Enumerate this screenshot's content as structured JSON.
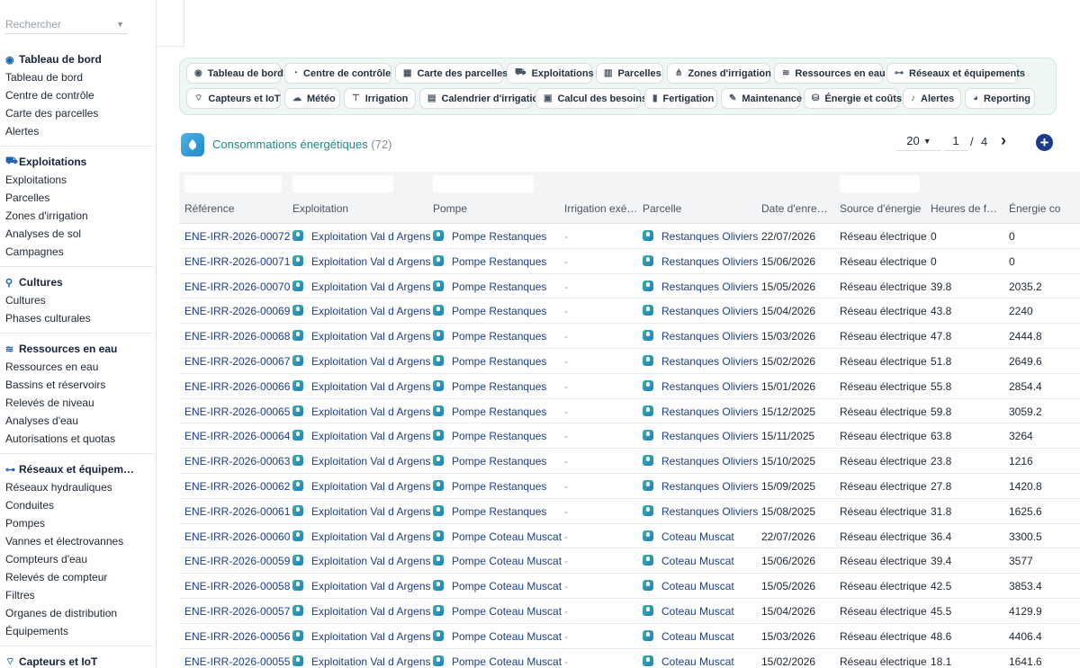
{
  "search": {
    "placeholder": "Rechercher"
  },
  "sidebar": {
    "sections": [
      {
        "title": "Tableau de bord",
        "icon": "dashboard-icon",
        "items": [
          "Tableau de bord",
          "Centre de contrôle",
          "Carte des parcelles",
          "Alertes"
        ]
      },
      {
        "title": "Exploitations",
        "icon": "tractor-icon",
        "items": [
          "Exploitations",
          "Parcelles",
          "Zones d'irrigation",
          "Analyses de sol",
          "Campagnes"
        ]
      },
      {
        "title": "Cultures",
        "icon": "sprout-icon",
        "items": [
          "Cultures",
          "Phases culturales"
        ]
      },
      {
        "title": "Ressources en eau",
        "icon": "water-waves-icon",
        "items": [
          "Ressources en eau",
          "Bassins et réservoirs",
          "Relevés de niveau",
          "Analyses d'eau",
          "Autorisations et quotas"
        ]
      },
      {
        "title": "Réseaux et équipem…",
        "icon": "network-icon",
        "items": [
          "Réseaux hydrauliques",
          "Conduites",
          "Pompes",
          "Vannes et électrovannes",
          "Compteurs d'eau",
          "Relevés de compteur",
          "Filtres",
          "Organes de distribution",
          "Équipements"
        ]
      },
      {
        "title": "Capteurs et IoT",
        "icon": "antenna-icon",
        "items": []
      }
    ]
  },
  "quicknav": {
    "row1": [
      {
        "label": "Tableau de bord",
        "icon": "dashboard-icon"
      },
      {
        "label": "Centre de contrôle",
        "icon": "control-icon"
      },
      {
        "label": "Carte des parcelles",
        "icon": "map-grid-icon"
      },
      {
        "label": "Exploitations",
        "icon": "tractor-icon"
      },
      {
        "label": "Parcelles",
        "icon": "map-icon"
      },
      {
        "label": "Zones d'irrigation",
        "icon": "sitemap-icon"
      },
      {
        "label": "Ressources en eau",
        "icon": "water-waves-icon"
      },
      {
        "label": "Réseaux et équipements",
        "icon": "network-icon"
      }
    ],
    "row2": [
      {
        "label": "Capteurs et IoT",
        "icon": "antenna-icon"
      },
      {
        "label": "Météo",
        "icon": "cloud-icon"
      },
      {
        "label": "Irrigation",
        "icon": "faucet-icon"
      },
      {
        "label": "Calendrier d'irrigation",
        "icon": "calendar-icon"
      },
      {
        "label": "Calcul des besoins",
        "icon": "calculator-icon"
      },
      {
        "label": "Fertigation",
        "icon": "flask-icon"
      },
      {
        "label": "Maintenance",
        "icon": "wrench-icon"
      },
      {
        "label": "Énergie et coûts",
        "icon": "coins-icon"
      },
      {
        "label": "Alertes",
        "icon": "bell-icon"
      },
      {
        "label": "Reporting",
        "icon": "pie-chart-icon"
      }
    ]
  },
  "list": {
    "title": "Consommations énergétiques",
    "count": "(72)"
  },
  "pager": {
    "page_size": "20",
    "page": "1",
    "separator": "/",
    "total_pages": "4"
  },
  "table": {
    "columns": [
      "Référence",
      "Exploitation",
      "Pompe",
      "Irrigation exé…",
      "Parcelle",
      "Date d'enreg…",
      "Source d'énergie",
      "Heures de fo…",
      "Énergie co"
    ],
    "rows": [
      {
        "ref": "ENE-IRR-2026-00072",
        "exploitation": "Exploitation Val d Argens",
        "pompe": "Pompe Restanques",
        "irrigation": "-",
        "parcelle": "Restanques Oliviers",
        "date": "22/07/2026",
        "source": "Réseau électrique",
        "heures": "0",
        "energie": "0"
      },
      {
        "ref": "ENE-IRR-2026-00071",
        "exploitation": "Exploitation Val d Argens",
        "pompe": "Pompe Restanques",
        "irrigation": "-",
        "parcelle": "Restanques Oliviers",
        "date": "15/06/2026",
        "source": "Réseau électrique",
        "heures": "0",
        "energie": "0"
      },
      {
        "ref": "ENE-IRR-2026-00070",
        "exploitation": "Exploitation Val d Argens",
        "pompe": "Pompe Restanques",
        "irrigation": "-",
        "parcelle": "Restanques Oliviers",
        "date": "15/05/2026",
        "source": "Réseau électrique",
        "heures": "39.8",
        "energie": "2035.2"
      },
      {
        "ref": "ENE-IRR-2026-00069",
        "exploitation": "Exploitation Val d Argens",
        "pompe": "Pompe Restanques",
        "irrigation": "-",
        "parcelle": "Restanques Oliviers",
        "date": "15/04/2026",
        "source": "Réseau électrique",
        "heures": "43.8",
        "energie": "2240"
      },
      {
        "ref": "ENE-IRR-2026-00068",
        "exploitation": "Exploitation Val d Argens",
        "pompe": "Pompe Restanques",
        "irrigation": "-",
        "parcelle": "Restanques Oliviers",
        "date": "15/03/2026",
        "source": "Réseau électrique",
        "heures": "47.8",
        "energie": "2444.8"
      },
      {
        "ref": "ENE-IRR-2026-00067",
        "exploitation": "Exploitation Val d Argens",
        "pompe": "Pompe Restanques",
        "irrigation": "-",
        "parcelle": "Restanques Oliviers",
        "date": "15/02/2026",
        "source": "Réseau électrique",
        "heures": "51.8",
        "energie": "2649.6"
      },
      {
        "ref": "ENE-IRR-2026-00066",
        "exploitation": "Exploitation Val d Argens",
        "pompe": "Pompe Restanques",
        "irrigation": "-",
        "parcelle": "Restanques Oliviers",
        "date": "15/01/2026",
        "source": "Réseau électrique",
        "heures": "55.8",
        "energie": "2854.4"
      },
      {
        "ref": "ENE-IRR-2026-00065",
        "exploitation": "Exploitation Val d Argens",
        "pompe": "Pompe Restanques",
        "irrigation": "-",
        "parcelle": "Restanques Oliviers",
        "date": "15/12/2025",
        "source": "Réseau électrique",
        "heures": "59.8",
        "energie": "3059.2"
      },
      {
        "ref": "ENE-IRR-2026-00064",
        "exploitation": "Exploitation Val d Argens",
        "pompe": "Pompe Restanques",
        "irrigation": "-",
        "parcelle": "Restanques Oliviers",
        "date": "15/11/2025",
        "source": "Réseau électrique",
        "heures": "63.8",
        "energie": "3264"
      },
      {
        "ref": "ENE-IRR-2026-00063",
        "exploitation": "Exploitation Val d Argens",
        "pompe": "Pompe Restanques",
        "irrigation": "-",
        "parcelle": "Restanques Oliviers",
        "date": "15/10/2025",
        "source": "Réseau électrique",
        "heures": "23.8",
        "energie": "1216"
      },
      {
        "ref": "ENE-IRR-2026-00062",
        "exploitation": "Exploitation Val d Argens",
        "pompe": "Pompe Restanques",
        "irrigation": "-",
        "parcelle": "Restanques Oliviers",
        "date": "15/09/2025",
        "source": "Réseau électrique",
        "heures": "27.8",
        "energie": "1420.8"
      },
      {
        "ref": "ENE-IRR-2026-00061",
        "exploitation": "Exploitation Val d Argens",
        "pompe": "Pompe Restanques",
        "irrigation": "-",
        "parcelle": "Restanques Oliviers",
        "date": "15/08/2025",
        "source": "Réseau électrique",
        "heures": "31.8",
        "energie": "1625.6"
      },
      {
        "ref": "ENE-IRR-2026-00060",
        "exploitation": "Exploitation Val d Argens",
        "pompe": "Pompe Coteau Muscat",
        "irrigation": "-",
        "parcelle": "Coteau Muscat",
        "date": "22/07/2026",
        "source": "Réseau électrique",
        "heures": "36.4",
        "energie": "3300.5"
      },
      {
        "ref": "ENE-IRR-2026-00059",
        "exploitation": "Exploitation Val d Argens",
        "pompe": "Pompe Coteau Muscat",
        "irrigation": "-",
        "parcelle": "Coteau Muscat",
        "date": "15/06/2026",
        "source": "Réseau électrique",
        "heures": "39.4",
        "energie": "3577"
      },
      {
        "ref": "ENE-IRR-2026-00058",
        "exploitation": "Exploitation Val d Argens",
        "pompe": "Pompe Coteau Muscat",
        "irrigation": "-",
        "parcelle": "Coteau Muscat",
        "date": "15/05/2026",
        "source": "Réseau électrique",
        "heures": "42.5",
        "energie": "3853.4"
      },
      {
        "ref": "ENE-IRR-2026-00057",
        "exploitation": "Exploitation Val d Argens",
        "pompe": "Pompe Coteau Muscat",
        "irrigation": "-",
        "parcelle": "Coteau Muscat",
        "date": "15/04/2026",
        "source": "Réseau électrique",
        "heures": "45.5",
        "energie": "4129.9"
      },
      {
        "ref": "ENE-IRR-2026-00056",
        "exploitation": "Exploitation Val d Argens",
        "pompe": "Pompe Coteau Muscat",
        "irrigation": "-",
        "parcelle": "Coteau Muscat",
        "date": "15/03/2026",
        "source": "Réseau électrique",
        "heures": "48.6",
        "energie": "4406.4"
      },
      {
        "ref": "ENE-IRR-2026-00055",
        "exploitation": "Exploitation Val d Argens",
        "pompe": "Pompe Coteau Muscat",
        "irrigation": "-",
        "parcelle": "Coteau Muscat",
        "date": "15/02/2026",
        "source": "Réseau électrique",
        "heures": "18.1",
        "energie": "1641.6"
      }
    ]
  }
}
